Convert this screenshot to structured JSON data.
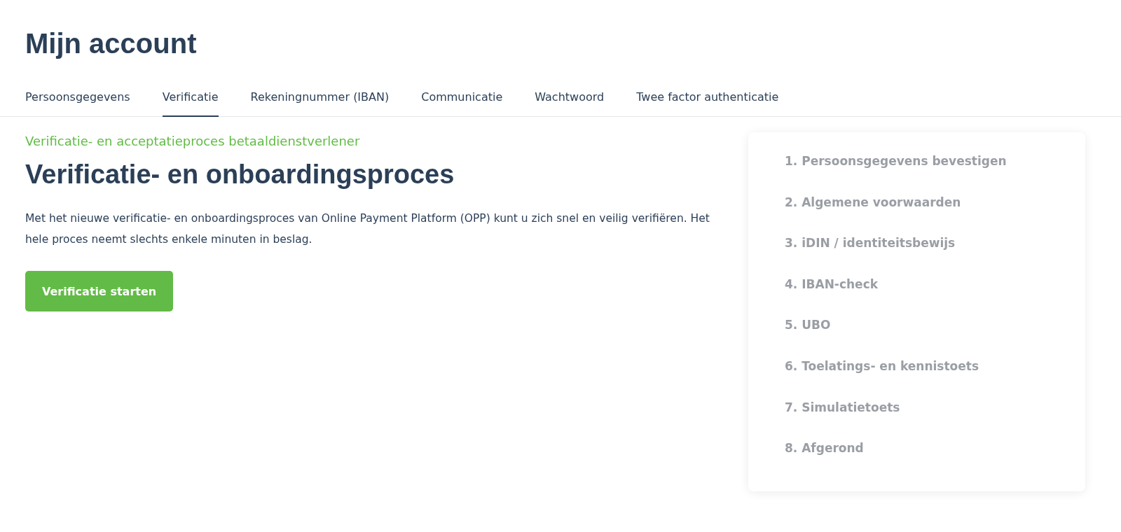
{
  "page": {
    "title": "Mijn account"
  },
  "tabs": [
    {
      "label": "Persoonsgegevens",
      "selected": false
    },
    {
      "label": "Verificatie",
      "selected": true
    },
    {
      "label": "Rekeningnummer (IBAN)",
      "selected": false
    },
    {
      "label": "Communicatie",
      "selected": false
    },
    {
      "label": "Wachtwoord",
      "selected": false
    },
    {
      "label": "Twee factor authenticatie",
      "selected": false
    }
  ],
  "content": {
    "eyebrow": "Verificatie- en acceptatieproces betaaldienstverlener",
    "heading": "Verificatie- en onboardingsproces",
    "body": "Met het nieuwe verificatie- en onboardingsproces van Online Payment Platform (OPP) kunt u zich snel en veilig verifiëren. Het hele proces neemt slechts enkele minuten in beslag.",
    "button": "Verificatie starten"
  },
  "steps": [
    "1. Persoonsgegevens bevestigen",
    "2. Algemene voorwaarden",
    "3. iDIN / identiteitsbewijs",
    "4. IBAN-check",
    "5. UBO",
    "6. Toelatings- en kennistoets",
    "7. Simulatietoets",
    "8. Afgerond"
  ]
}
